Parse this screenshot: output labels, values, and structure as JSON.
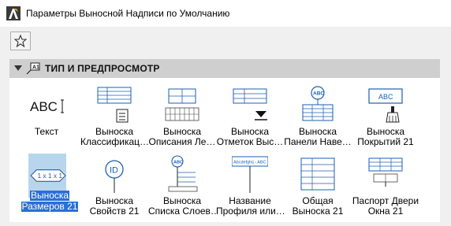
{
  "window": {
    "title": "Параметры Выносной Надписи по Умолчанию"
  },
  "toolbar": {
    "favorites_icon": "star-icon"
  },
  "section": {
    "title": "ТИП И ПРЕДПРОСМОТР",
    "expanded": true
  },
  "items": [
    {
      "line1": "Текст",
      "line2": "",
      "icon": "text-abc-icon"
    },
    {
      "line1": "Выноска",
      "line2": "Классификац…",
      "icon": "classification-label-icon"
    },
    {
      "line1": "Выноска",
      "line2": "Описания Ле…",
      "icon": "stair-description-label-icon"
    },
    {
      "line1": "Выноска",
      "line2": "Отметок Выс…",
      "icon": "elevation-label-icon"
    },
    {
      "line1": "Выноска",
      "line2": "Панели Наве…",
      "icon": "curtain-wall-panel-label-icon"
    },
    {
      "line1": "Выноска",
      "line2": "Покрытий 21",
      "icon": "surface-label-icon"
    },
    {
      "line1": "Выноска",
      "line2": "Размеров 21",
      "icon": "dimension-label-icon",
      "selected": true
    },
    {
      "line1": "Выноска",
      "line2": "Свойств 21",
      "icon": "property-id-label-icon"
    },
    {
      "line1": "Выноска",
      "line2": "Списка Слоев…",
      "icon": "layer-list-label-icon"
    },
    {
      "line1": "Название",
      "line2": "Профиля или…",
      "icon": "profile-name-label-icon"
    },
    {
      "line1": "Общая",
      "line2": "Выноска 21",
      "icon": "general-label-icon"
    },
    {
      "line1": "Паспорт Двери",
      "line2": "Окна 21",
      "icon": "door-window-passport-icon"
    }
  ],
  "previews": {
    "text_sample": "ABC",
    "badge_abc": "ABC",
    "id_text": "ID",
    "dimension_text": "1 x 1 x 1",
    "profile_text": "Abcdefghij - ABC"
  },
  "colors": {
    "accent_blue": "#2a6fd6",
    "selection_bg": "#b7d6ee",
    "icon_blue": "#1b5fb5",
    "section_header": "#cfcfcf"
  }
}
